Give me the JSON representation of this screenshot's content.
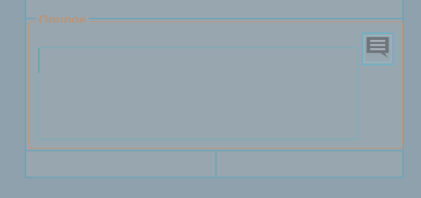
{
  "description_section": {
    "legend": "Opunoe",
    "textarea_value": "",
    "textarea_placeholder": ""
  },
  "comment_button": {
    "icon": "comment-lines-icon"
  },
  "colors": {
    "background": "#8fa1ad",
    "panel": "#98a6af",
    "panel_border": "#6fa3b4",
    "fieldset_border": "#c29470",
    "legend_text": "#b89477",
    "input_border": "#71b3b8",
    "icon_fill": "#6e757a"
  }
}
